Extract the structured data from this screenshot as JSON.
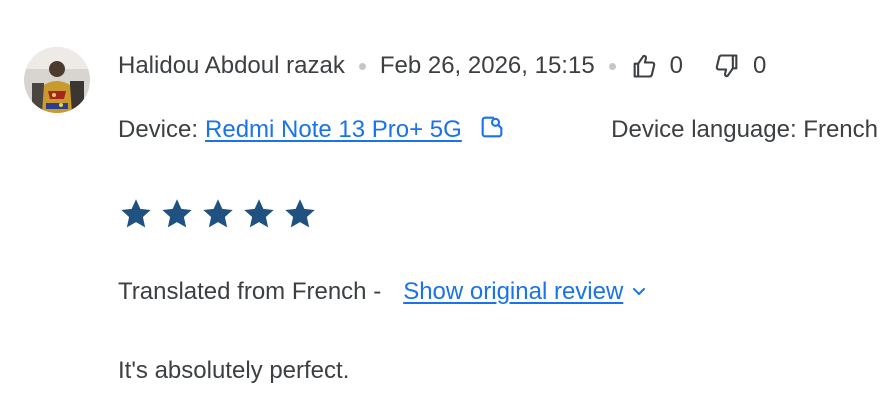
{
  "review": {
    "author": "Halidou Abdoul razak",
    "date": "Feb 26, 2026, 15:15",
    "thumbs_up_count": "0",
    "thumbs_down_count": "0",
    "device_label": "Device:",
    "device_name": "Redmi Note 13 Pro+ 5G",
    "device_language": "Device language: French",
    "rating": 5,
    "rating_max": 5,
    "translated_label": "Translated from French -",
    "show_original_label": "Show original review",
    "text": "It's absolutely perfect."
  },
  "colors": {
    "star": "#1f5280",
    "link": "#1a73e8",
    "text": "#3c4043"
  },
  "icons": {
    "thumbs_up": "thumbs-up-icon",
    "thumbs_down": "thumbs-down-icon",
    "open_in_new": "open-device-icon",
    "chevron": "chevron-down-icon"
  }
}
